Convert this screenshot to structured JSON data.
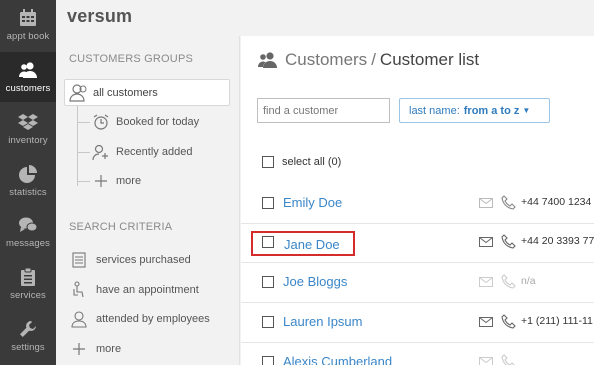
{
  "brand": {
    "logo": "versum"
  },
  "nav": [
    {
      "label": "appt book",
      "icon": "calendar-icon"
    },
    {
      "label": "customers",
      "icon": "users-icon"
    },
    {
      "label": "inventory",
      "icon": "dropbox-icon"
    },
    {
      "label": "statistics",
      "icon": "pie-chart-icon"
    },
    {
      "label": "messages",
      "icon": "chat-icon"
    },
    {
      "label": "services",
      "icon": "clipboard-icon"
    },
    {
      "label": "settings",
      "icon": "wrench-icon"
    }
  ],
  "groups": {
    "title": "CUSTOMERS GROUPS",
    "all": "all customers",
    "items": [
      {
        "label": "Booked for today",
        "icon": "alarm-clock-icon"
      },
      {
        "label": "Recently added",
        "icon": "add-user-icon"
      },
      {
        "label": "more",
        "icon": "plus-icon"
      }
    ]
  },
  "criteria": {
    "title": "SEARCH CRITERIA",
    "items": [
      {
        "label": "services purchased",
        "icon": "list-icon"
      },
      {
        "label": "have an appointment",
        "icon": "person-chair-icon"
      },
      {
        "label": "attended by employees",
        "icon": "employee-icon"
      },
      {
        "label": "more",
        "icon": "plus-icon"
      }
    ]
  },
  "main": {
    "breadcrumb": "Customers",
    "separator": "/",
    "current": "Customer list",
    "search_placeholder": "find a customer",
    "sort_prefix": "last name:",
    "sort_value": "from a to z",
    "select_all": "select all (0)"
  },
  "customers": [
    {
      "name": "Emily Doe",
      "phone": "+44 7400 1234",
      "has_email": false,
      "has_phone": false
    },
    {
      "name": "Jane Doe",
      "phone": "+44 20 3393 77",
      "has_email": true,
      "has_phone": true,
      "highlighted": true
    },
    {
      "name": "Joe Bloggs",
      "phone": "n/a",
      "has_email": false,
      "has_phone": false
    },
    {
      "name": "Lauren Ipsum",
      "phone": "+1 (211) 111-11",
      "has_email": true,
      "has_phone": true
    },
    {
      "name": "Alexis Cumberland",
      "phone": "",
      "has_email": false,
      "has_phone": false
    }
  ],
  "colors": {
    "nav_bg": "#3a3a3a",
    "link": "#3a86c8",
    "highlight_box": "#d62b2b"
  }
}
